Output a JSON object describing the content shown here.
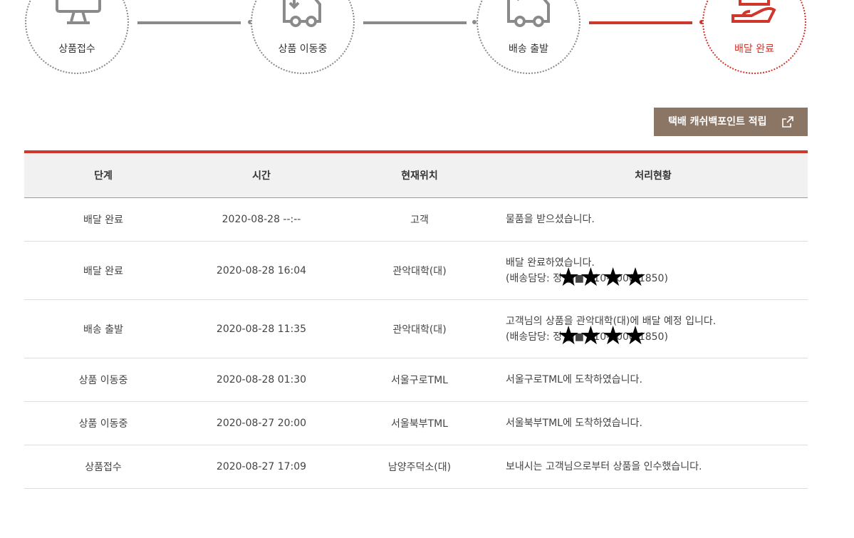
{
  "steps": [
    {
      "label": "상품접수",
      "icon": "monitor-arrow-icon",
      "active": false
    },
    {
      "label": "상품 이동중",
      "icon": "truck-move-icon",
      "active": false
    },
    {
      "label": "배송 출발",
      "icon": "truck-depart-icon",
      "active": false
    },
    {
      "label": "배달 완료",
      "icon": "hand-package-icon",
      "active": true
    }
  ],
  "cashback_button": {
    "label": "택배 캐쉬백포인트 적립",
    "icon": "external-link-icon"
  },
  "table": {
    "headers": [
      "단계",
      "시간",
      "현재위치",
      "처리현황"
    ],
    "rows": [
      {
        "stage": "배달 완료",
        "time": "2020-08-28 --:--",
        "location": "고객",
        "status": "물품을 받으셨습니다.",
        "status2": ""
      },
      {
        "stage": "배달 완료",
        "time": "2020-08-28 16:04",
        "location": "관악대학(대)",
        "status": "배달 완료하였습니다.",
        "status2": "(배송담당: 정 ■■ 010-3000-1850)",
        "mask": "★★★★"
      },
      {
        "stage": "배송 출발",
        "time": "2020-08-28 11:35",
        "location": "관악대학(대)",
        "status": "고객님의 상품을 관악대학(대)에 배달 예정 입니다.",
        "status2": "(배송담당: 정 ■■ 010-3000-1850)",
        "mask": "★★★★"
      },
      {
        "stage": "상품 이동중",
        "time": "2020-08-28 01:30",
        "location": "서울구로TML",
        "status": "서울구로TML에 도착하였습니다.",
        "status2": ""
      },
      {
        "stage": "상품 이동중",
        "time": "2020-08-27 20:00",
        "location": "서울북부TML",
        "status": "서울북부TML에 도착하였습니다.",
        "status2": ""
      },
      {
        "stage": "상품접수",
        "time": "2020-08-27 17:09",
        "location": "남양주덕소(대)",
        "status": "보내시는 고객님으로부터 상품을 인수했습니다.",
        "status2": ""
      }
    ]
  },
  "colors": {
    "accent": "#d0362c",
    "inactive": "#8a8a8a",
    "button_bg": "#8b7565"
  }
}
